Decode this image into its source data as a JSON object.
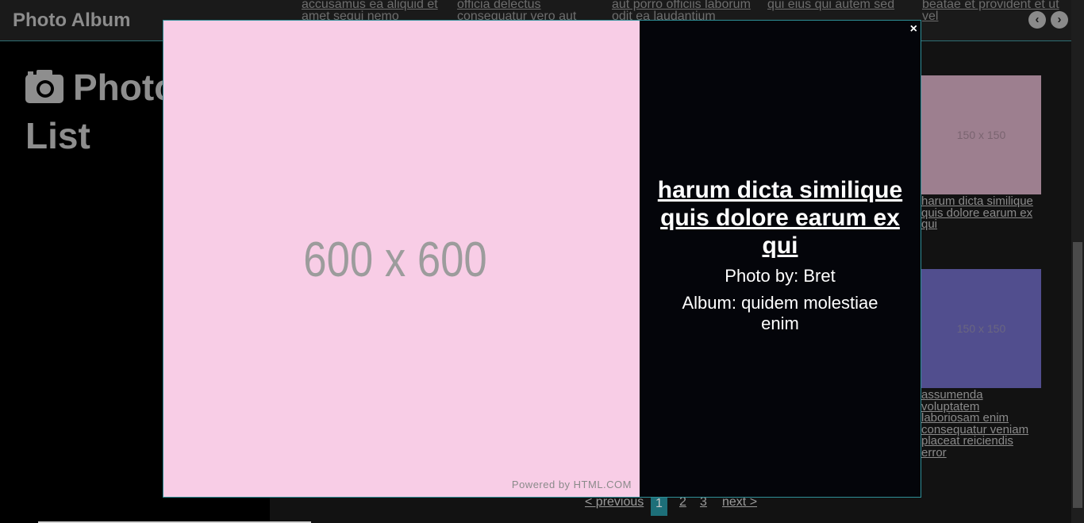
{
  "brand": "Photo Album",
  "sidebar": {
    "title_line1": "Photo",
    "title_line2": "List"
  },
  "top_captions": [
    "accusamus ea aliquid et amet sequi nemo",
    "officia delectus consequatur vero aut veniam",
    "aut porro officiis laborum odit ea laudantium",
    "qui eius qui autem sed",
    "beatae et provident et ut vel"
  ],
  "thumbnails": [
    {
      "label": "150 x 150",
      "caption": "harum dicta similique quis dolore earum ex qui",
      "color": "#9d7f8f"
    },
    {
      "label": "150 x 150",
      "caption": "assumenda voluptatem laboriosam enim consequatur veniam placeat reiciendis error",
      "color": "#514e8e"
    }
  ],
  "pagination": {
    "previous": "< previous",
    "pages": [
      "1",
      "2",
      "3"
    ],
    "active": "1",
    "next": "next >"
  },
  "lightbox": {
    "image_label": "600 x 600",
    "image_color": "#f8cde6",
    "powered_by": "Powered by HTML.COM",
    "title": "harum dicta similique quis dolore earum ex qui",
    "photo_by": "Photo by: Bret",
    "album": "Album: quidem molestiae enim",
    "close": "×"
  }
}
